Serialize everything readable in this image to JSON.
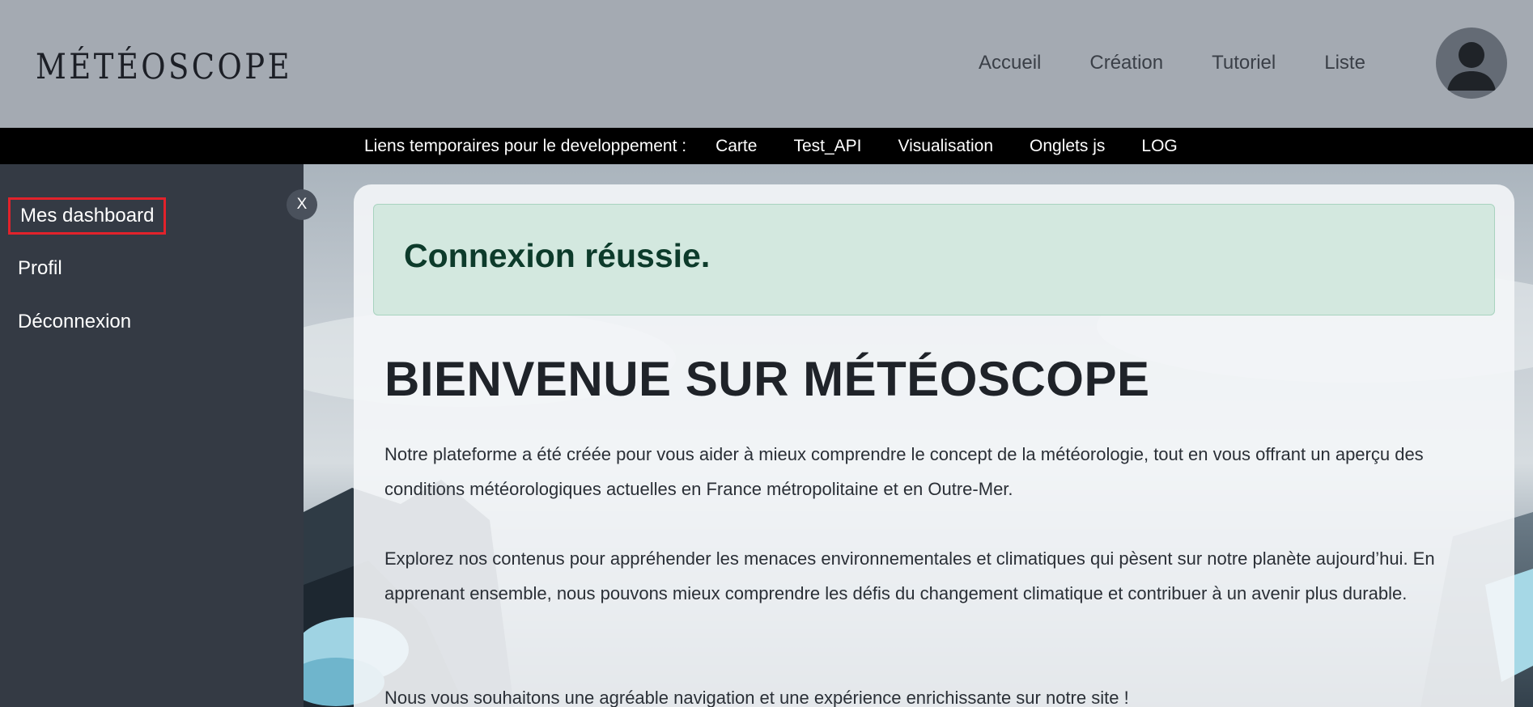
{
  "header": {
    "logo": "MÉTÉOSCOPE",
    "nav": [
      "Accueil",
      "Création",
      "Tutoriel",
      "Liste"
    ]
  },
  "devbar": {
    "label": "Liens temporaires pour le developpement :",
    "links": [
      "Carte",
      "Test_API",
      "Visualisation",
      "Onglets js",
      "LOG"
    ]
  },
  "sidebar": {
    "close_label": "X",
    "items": [
      {
        "label": "Mes dashboard"
      },
      {
        "label": "Profil"
      },
      {
        "label": "Déconnexion"
      }
    ]
  },
  "main": {
    "alert": "Connexion réussie.",
    "title": "BIENVENUE SUR MÉTÉOSCOPE",
    "paragraphs": [
      "Notre plateforme a été créée pour vous aider à mieux comprendre le concept de la météorologie, tout en vous offrant un aperçu des conditions météorologiques actuelles en France métropolitaine et en Outre-Mer.",
      "Explorez nos contenus pour appréhender les menaces environnementales et climatiques qui pèsent sur notre planète aujourd’hui. En apprenant ensemble, nous pouvons mieux comprendre les défis du changement climatique et contribuer à un avenir plus durable.",
      "Nous vous souhaitons une agréable navigation et une expérience enrichissante sur notre site !"
    ]
  },
  "colors": {
    "header_bg": "#a4aab2",
    "devbar_bg": "#000000",
    "sidebar_bg": "#343a44",
    "alert_bg": "#d3e8df",
    "active_outline": "#e2222b"
  },
  "icons": {
    "avatar": "user-avatar-icon"
  }
}
